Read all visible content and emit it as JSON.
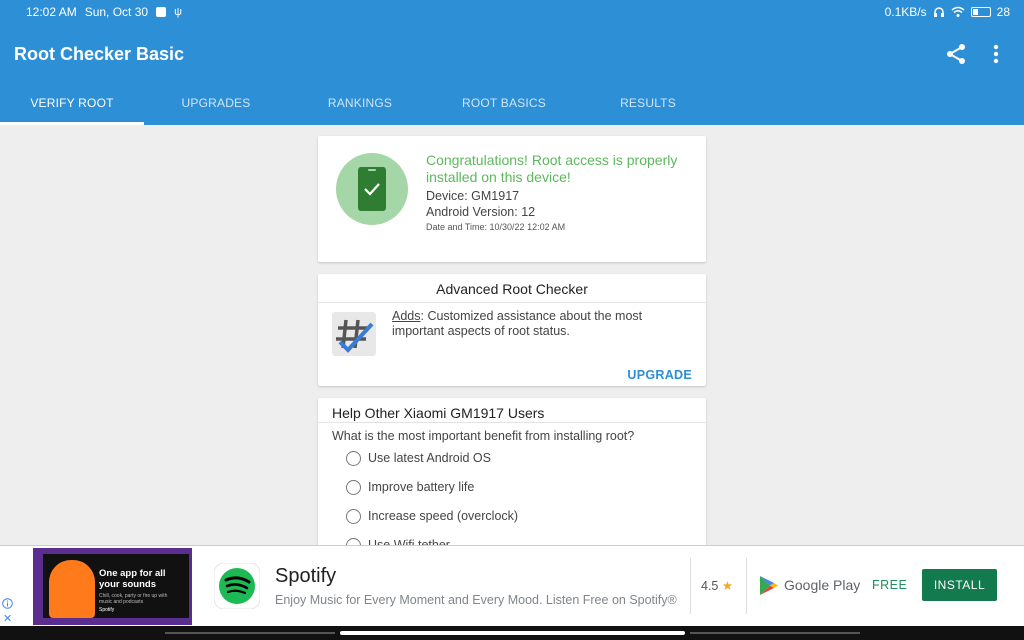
{
  "status_bar": {
    "time": "12:02 AM",
    "date": "Sun, Oct 30",
    "speed": "0.1KB/s",
    "battery": "28"
  },
  "app": {
    "title": "Root Checker Basic",
    "icons": [
      "share-icon",
      "more-vert-icon"
    ]
  },
  "tabs": [
    {
      "label": "VERIFY ROOT",
      "active": true
    },
    {
      "label": "UPGRADES",
      "active": false
    },
    {
      "label": "RANKINGS",
      "active": false
    },
    {
      "label": "ROOT BASICS",
      "active": false
    },
    {
      "label": "RESULTS",
      "active": false
    }
  ],
  "root_status": {
    "message": "Congratulations! Root access is properly installed on this device!",
    "device": "Device: GM1917",
    "android_version": "Android Version: 12",
    "date_time": "Date and Time: 10/30/22 12:02 AM",
    "icon": "phone-check-icon"
  },
  "advanced": {
    "title": "Advanced Root Checker",
    "adds_link": "Adds",
    "description": ": Customized assistance about the most important aspects of root status.",
    "upgrade_label": "UPGRADE"
  },
  "survey": {
    "title": "Help Other Xiaomi GM1917 Users",
    "question": "What is the most important benefit from installing root?",
    "options": [
      "Use latest Android OS",
      "Improve battery life",
      "Increase speed (overclock)",
      "Use Wifi tether"
    ]
  },
  "ad": {
    "thumb_headline": "One app for all your sounds",
    "thumb_small": "Chill, cook, party or fire up with music and podcasts",
    "thumb_brand": "Spotify",
    "brand": "Spotify",
    "tagline": "Enjoy Music for Every Moment and Every Mood. Listen Free on Spotify®",
    "rating": "4.5",
    "store": "Google Play",
    "price": "FREE",
    "install_label": "INSTALL"
  },
  "colors": {
    "primary": "#2d8fd5",
    "success": "#5cb85c",
    "success_circle": "#a5d6a7",
    "install_green": "#137a4e"
  }
}
